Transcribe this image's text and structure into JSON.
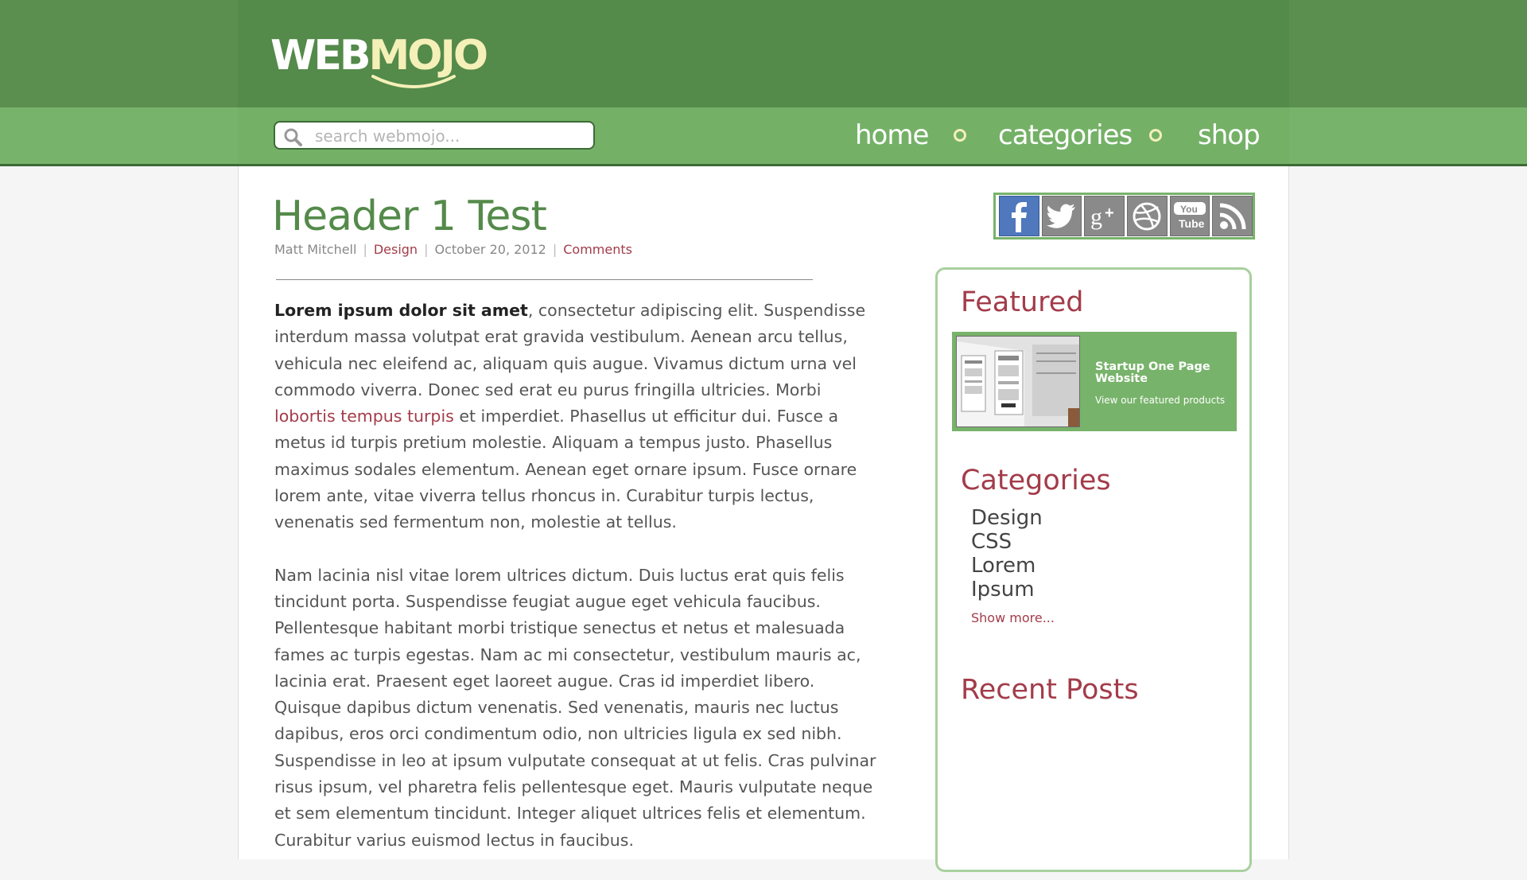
{
  "brand": {
    "logo_part1": "WEB",
    "logo_part2": "MOJO"
  },
  "search": {
    "placeholder": "search webmojo..."
  },
  "nav": {
    "items": [
      {
        "label": "home"
      },
      {
        "label": "categories"
      },
      {
        "label": "shop"
      }
    ]
  },
  "post": {
    "title": "Header 1 Test",
    "author": "Matt Mitchell",
    "category": "Design",
    "date": "October 20, 2012",
    "comments_label": "Comments",
    "p1_bold": "Lorem ipsum dolor sit amet",
    "p1_before_link": ", consectetur adipiscing elit. Suspendisse interdum massa volutpat erat gravida vestibulum. Aenean arcu tellus, vehicula nec eleifend ac, aliquam quis augue. Vivamus dictum urna vel commodo viverra. Donec sed erat eu purus fringilla ultricies. Morbi ",
    "p1_link": "lobortis tempus turpis",
    "p1_after_link": " et imperdiet. Phasellus ut efficitur dui. Fusce a metus id turpis pretium molestie. Aliquam a tempus justo. Phasellus maximus sodales elementum. Aenean eget ornare ipsum. Fusce ornare lorem ante, vitae viverra tellus rhoncus in. Curabitur turpis lectus, venenatis sed fermentum non, molestie at tellus.",
    "p2": "Nam lacinia nisl vitae lorem ultrices dictum. Duis luctus erat quis felis tincidunt porta. Suspendisse feugiat augue eget vehicula faucibus. Pellentesque habitant morbi tristique senectus et netus et malesuada fames ac turpis egestas. Nam ac mi consectetur, vestibulum mauris ac, lacinia erat. Praesent eget laoreet augue. Cras id imperdiet libero. Quisque dapibus dictum venenatis. Sed venenatis, mauris nec luctus dapibus, eros orci condimentum odio, non ultricies ligula ex sed nibh. Suspendisse in leo at ipsum vulputate consequat at ut felis. Cras pulvinar risus ipsum, vel pharetra felis pellentesque eget. Mauris vulputate neque et sem elementum tincidunt. Integer aliquet ultrices felis et elementum. Curabitur varius euismod lectus in faucibus."
  },
  "social": [
    {
      "name": "facebook-icon",
      "label": "f"
    },
    {
      "name": "twitter-icon",
      "label": "twitter"
    },
    {
      "name": "google-plus-icon",
      "label": "g+"
    },
    {
      "name": "dribbble-icon",
      "label": "dribbble"
    },
    {
      "name": "youtube-icon",
      "label": "You Tube"
    },
    {
      "name": "rss-icon",
      "label": "rss"
    }
  ],
  "sidebar": {
    "featured": {
      "heading": "Featured",
      "title": "Startup One Page Website",
      "link": "View our featured products"
    },
    "categories": {
      "heading": "Categories",
      "items": [
        "Design",
        "CSS",
        "Lorem",
        "Ipsum"
      ],
      "show_more": "Show more..."
    },
    "recent": {
      "heading": "Recent Posts"
    }
  },
  "colors": {
    "header": "#548a4a",
    "nav": "#77b36a",
    "accent": "#a33c4a",
    "logo_highlight": "#f4f0b8"
  }
}
